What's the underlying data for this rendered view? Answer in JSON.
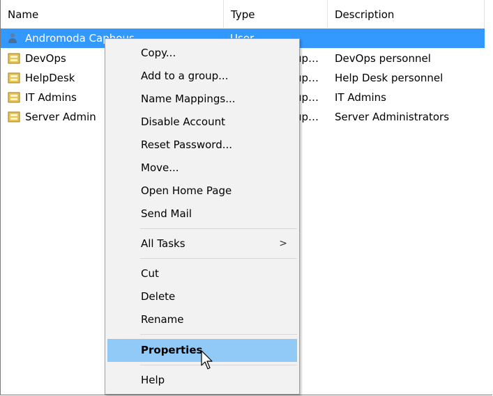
{
  "columns": {
    "name": "Name",
    "type": "Type",
    "description": "Description"
  },
  "rows": [
    {
      "name": "Andromoda Caphous",
      "type": "User",
      "description": "",
      "icon": "user-icon",
      "selected": true
    },
    {
      "name": "DevOps",
      "type": "Security Group - Global...",
      "description": "DevOps personnel",
      "icon": "group-icon"
    },
    {
      "name": "HelpDesk",
      "type": "Security Group - Global...",
      "description": "Help Desk personnel",
      "icon": "group-icon"
    },
    {
      "name": "IT Admins",
      "type": "Security Group - Global...",
      "description": "IT Admins",
      "icon": "group-icon"
    },
    {
      "name": "Server Admin",
      "type": "Security Group - Global...",
      "description": "Server Administrators",
      "icon": "group-icon"
    }
  ],
  "context_menu": {
    "items": [
      "Copy...",
      "Add to a group...",
      "Name Mappings...",
      "Disable Account",
      "Reset Password...",
      "Move...",
      "Open Home Page",
      "Send Mail",
      "All Tasks",
      "Cut",
      "Delete",
      "Rename",
      "Properties",
      "Help"
    ],
    "submenu_arrow": ">",
    "highlighted": "Properties"
  },
  "colors": {
    "selection": "#3399ff",
    "menu_highlight": "#91c9f7",
    "menu_background": "#f2f2f2"
  }
}
